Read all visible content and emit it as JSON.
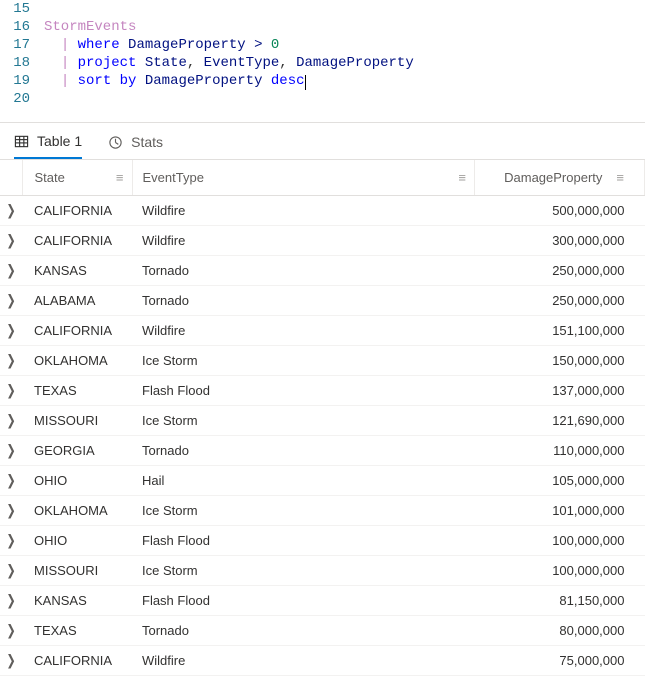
{
  "editor": {
    "lines": [
      {
        "num": "15",
        "tokens": []
      },
      {
        "num": "16",
        "tokens": [
          {
            "cls": "tok-ident",
            "t": "StormEvents"
          }
        ]
      },
      {
        "num": "17",
        "tokens": [
          {
            "cls": "tok-plain",
            "t": "  "
          },
          {
            "cls": "tok-pipe",
            "t": "|"
          },
          {
            "cls": "tok-plain",
            "t": " "
          },
          {
            "cls": "tok-kw",
            "t": "where"
          },
          {
            "cls": "tok-plain",
            "t": " "
          },
          {
            "cls": "tok-col",
            "t": "DamageProperty"
          },
          {
            "cls": "tok-plain",
            "t": " "
          },
          {
            "cls": "tok-op",
            "t": ">"
          },
          {
            "cls": "tok-plain",
            "t": " "
          },
          {
            "cls": "tok-num",
            "t": "0"
          }
        ]
      },
      {
        "num": "18",
        "tokens": [
          {
            "cls": "tok-plain",
            "t": "  "
          },
          {
            "cls": "tok-pipe",
            "t": "|"
          },
          {
            "cls": "tok-plain",
            "t": " "
          },
          {
            "cls": "tok-kw",
            "t": "project"
          },
          {
            "cls": "tok-plain",
            "t": " "
          },
          {
            "cls": "tok-col",
            "t": "State"
          },
          {
            "cls": "tok-plain",
            "t": ", "
          },
          {
            "cls": "tok-col",
            "t": "EventType"
          },
          {
            "cls": "tok-plain",
            "t": ", "
          },
          {
            "cls": "tok-col",
            "t": "DamageProperty"
          }
        ]
      },
      {
        "num": "19",
        "tokens": [
          {
            "cls": "tok-plain",
            "t": "  "
          },
          {
            "cls": "tok-pipe",
            "t": "|"
          },
          {
            "cls": "tok-plain",
            "t": " "
          },
          {
            "cls": "tok-kw",
            "t": "sort"
          },
          {
            "cls": "tok-plain",
            "t": " "
          },
          {
            "cls": "tok-kw",
            "t": "by"
          },
          {
            "cls": "tok-plain",
            "t": " "
          },
          {
            "cls": "tok-col",
            "t": "DamageProperty"
          },
          {
            "cls": "tok-plain",
            "t": " "
          },
          {
            "cls": "tok-kw",
            "t": "desc"
          }
        ],
        "cursor_after": true
      },
      {
        "num": "20",
        "tokens": []
      }
    ]
  },
  "tabs": {
    "table": "Table 1",
    "stats": "Stats"
  },
  "columns": {
    "state": "State",
    "event": "EventType",
    "damage": "DamageProperty"
  },
  "menu_glyph": "≡",
  "expand_glyph": "❯",
  "rows": [
    {
      "state": "CALIFORNIA",
      "event": "Wildfire",
      "damage": "500,000,000"
    },
    {
      "state": "CALIFORNIA",
      "event": "Wildfire",
      "damage": "300,000,000"
    },
    {
      "state": "KANSAS",
      "event": "Tornado",
      "damage": "250,000,000"
    },
    {
      "state": "ALABAMA",
      "event": "Tornado",
      "damage": "250,000,000"
    },
    {
      "state": "CALIFORNIA",
      "event": "Wildfire",
      "damage": "151,100,000"
    },
    {
      "state": "OKLAHOMA",
      "event": "Ice Storm",
      "damage": "150,000,000"
    },
    {
      "state": "TEXAS",
      "event": "Flash Flood",
      "damage": "137,000,000"
    },
    {
      "state": "MISSOURI",
      "event": "Ice Storm",
      "damage": "121,690,000"
    },
    {
      "state": "GEORGIA",
      "event": "Tornado",
      "damage": "110,000,000"
    },
    {
      "state": "OHIO",
      "event": "Hail",
      "damage": "105,000,000"
    },
    {
      "state": "OKLAHOMA",
      "event": "Ice Storm",
      "damage": "101,000,000"
    },
    {
      "state": "OHIO",
      "event": "Flash Flood",
      "damage": "100,000,000"
    },
    {
      "state": "MISSOURI",
      "event": "Ice Storm",
      "damage": "100,000,000"
    },
    {
      "state": "KANSAS",
      "event": "Flash Flood",
      "damage": "81,150,000"
    },
    {
      "state": "TEXAS",
      "event": "Tornado",
      "damage": "80,000,000"
    },
    {
      "state": "CALIFORNIA",
      "event": "Wildfire",
      "damage": "75,000,000"
    }
  ]
}
